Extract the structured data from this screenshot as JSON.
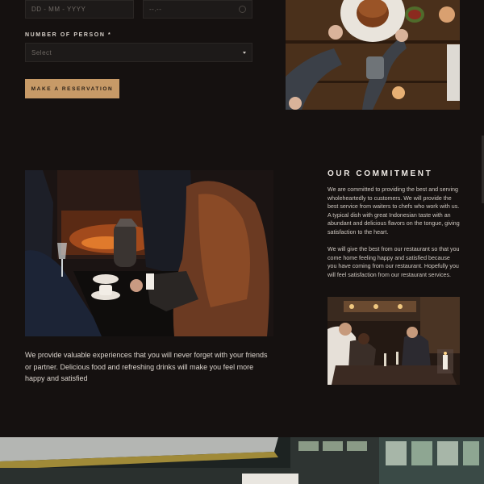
{
  "reservation": {
    "date_placeholder": "DD - MM - YYYY",
    "time_placeholder": "--.--",
    "persons_label": "NUMBER OF PERSON *",
    "persons_select_value": "Select",
    "submit_label": "MAKE A RESERVATION"
  },
  "commitment": {
    "title": "OUR COMMITMENT",
    "paragraph1": "We are committed to providing the best and serving wholeheartedly to customers. We will provide the best service from waiters to chefs who work with us. A typical dish with great Indonesian taste with an abundant and delicious flavors on the tongue, giving satisfaction to the heart.",
    "paragraph2": "We will give the best from our restaurant so that you come home feeling happy and satisfied because you have coming from our restaurant. Hopefully you will feel satisfaction from our restaurant services."
  },
  "experience": {
    "text": "We provide valuable experiences that you will never forget with your friends or partner. Delicious food and refreshing drinks will make you feel more happy and satisfied"
  },
  "colors": {
    "background": "#151110",
    "accent": "#c79a67",
    "field_background": "#1d1a19"
  }
}
